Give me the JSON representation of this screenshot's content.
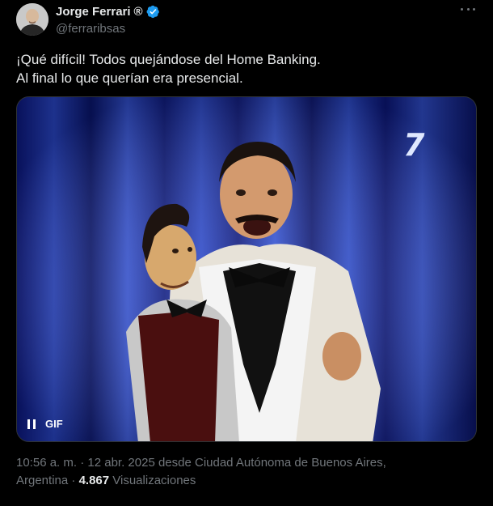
{
  "author": {
    "display_name": "Jorge Ferrari",
    "registered_mark": "®",
    "handle": "@ferraribsas",
    "verified": true,
    "verified_color": "#1d9bf0"
  },
  "tweet": {
    "text_line1": "¡Qué difícil! Todos quejándose del Home Banking.",
    "text_line2": "Al final lo que querían era presencial."
  },
  "media": {
    "type": "gif",
    "badge_label": "GIF",
    "control_icon": "pause-icon",
    "channel_logo": "7"
  },
  "meta": {
    "timestamp_location_line1": "10:56 a. m. · 12 abr. 2025 desde Ciudad Autónoma de Buenos Aires,",
    "location_line2": "Argentina",
    "separator": " · ",
    "views_count": "4.867",
    "views_label": " Visualizaciones"
  },
  "colors": {
    "background": "#000000",
    "text_primary": "#e7e9ea",
    "text_secondary": "#71767b",
    "border": "#2f3336"
  }
}
